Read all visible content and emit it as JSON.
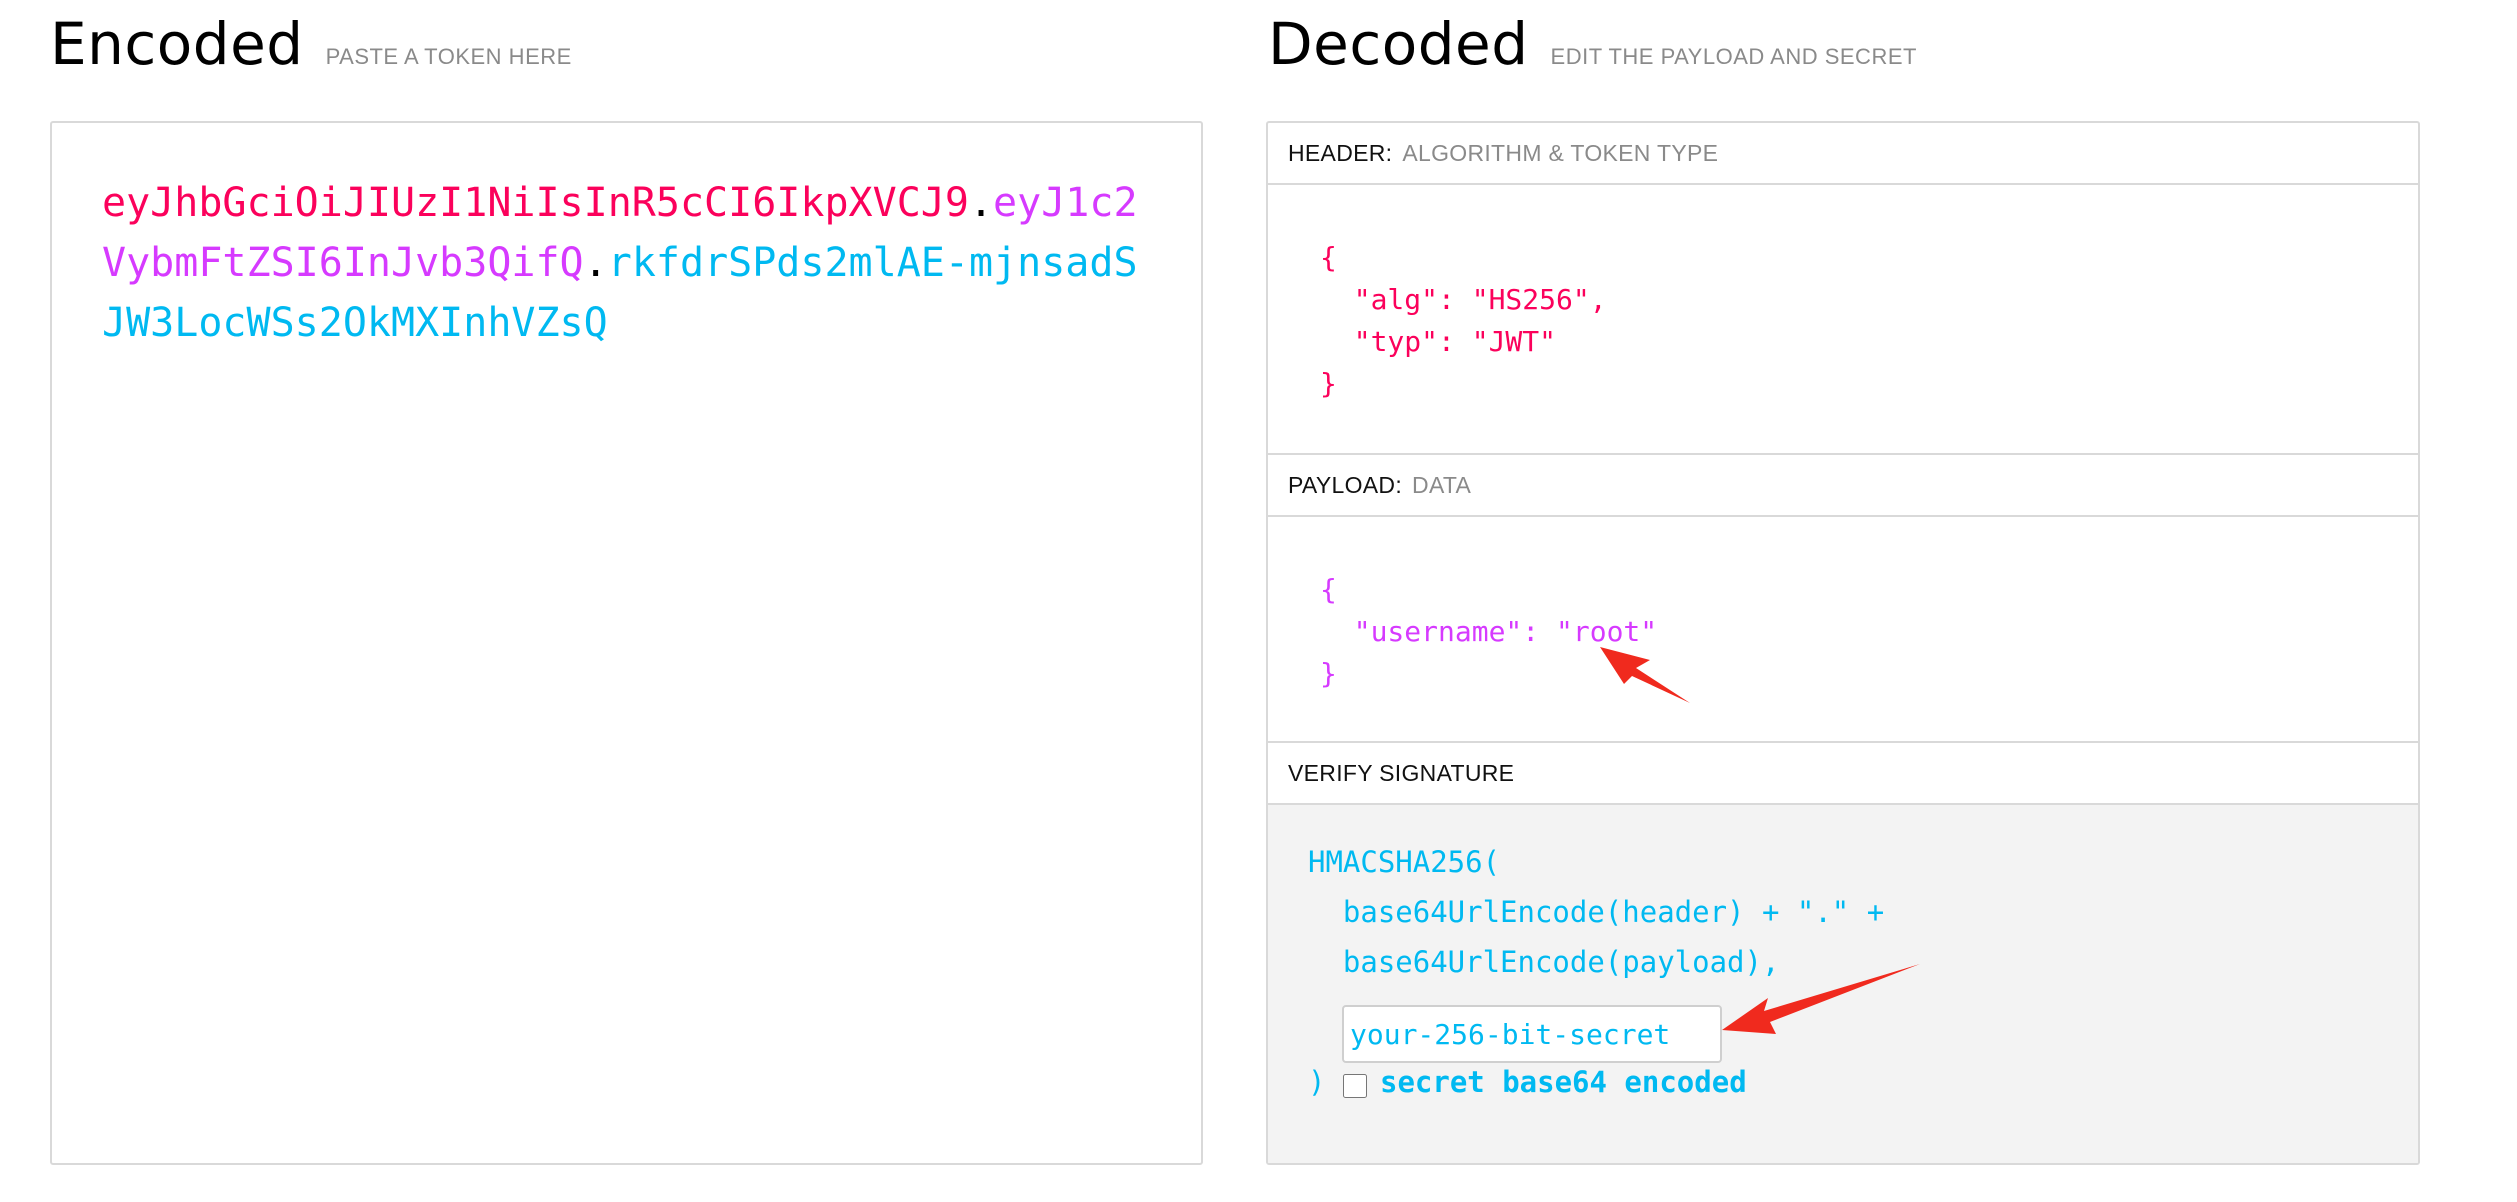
{
  "encoded": {
    "title": "Encoded",
    "subtitle": "PASTE A TOKEN HERE",
    "token": {
      "header_part": "eyJhbGciOiJIUzI1NiIsInR5cCI6IkpXVCJ9",
      "payload_part": "eyJ1c2VybmFtZSI6InJvb3QifQ",
      "signature_part": "rkfdrSPds2mlAE-mjnsadSJW3LocWSs2OkMXInhVZsQ",
      "separator": "."
    }
  },
  "decoded": {
    "title": "Decoded",
    "subtitle": "EDIT THE PAYLOAD AND SECRET",
    "header_section": {
      "label": "HEADER:",
      "sublabel": "ALGORITHM & TOKEN TYPE",
      "json_lines": [
        "{",
        "  \"alg\": \"HS256\",",
        "  \"typ\": \"JWT\"",
        "}"
      ]
    },
    "payload_section": {
      "label": "PAYLOAD:",
      "sublabel": "DATA",
      "json_lines": [
        "{",
        "  \"username\": \"root\"",
        "}"
      ]
    },
    "verify_section": {
      "label": "VERIFY SIGNATURE",
      "line1": "HMACSHA256(",
      "line2": "  base64UrlEncode(header) + \".\" +",
      "line3": "  base64UrlEncode(payload),",
      "secret_placeholder": "your-256-bit-secret",
      "close_paren": ")",
      "checkbox_label": "secret base64 encoded",
      "checkbox_checked": false
    }
  },
  "colors": {
    "header": "#fb015b",
    "payload": "#d63aff",
    "signature": "#00b9f1",
    "annotation_arrow": "#f02a1e"
  }
}
